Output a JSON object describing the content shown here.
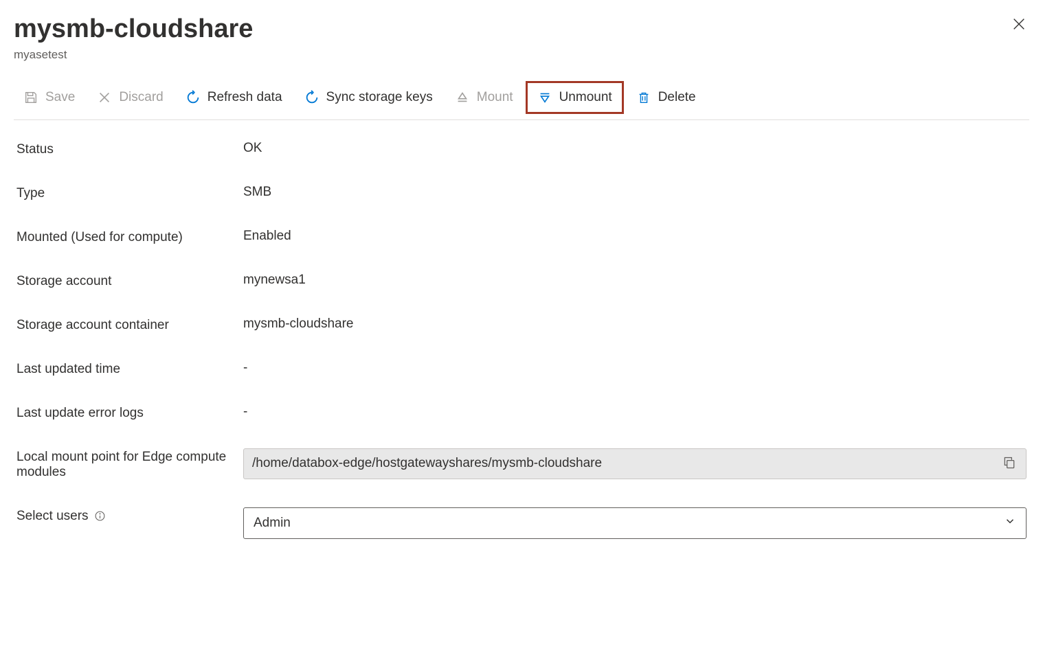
{
  "header": {
    "title": "mysmb-cloudshare",
    "subtitle": "myasetest"
  },
  "toolbar": {
    "save": "Save",
    "discard": "Discard",
    "refresh": "Refresh data",
    "sync": "Sync storage keys",
    "mount": "Mount",
    "unmount": "Unmount",
    "delete": "Delete"
  },
  "fields": {
    "status": {
      "label": "Status",
      "value": "OK"
    },
    "type": {
      "label": "Type",
      "value": "SMB"
    },
    "mounted": {
      "label": "Mounted (Used for compute)",
      "value": "Enabled"
    },
    "storage_account": {
      "label": "Storage account",
      "value": "mynewsa1"
    },
    "storage_account_container": {
      "label": "Storage account container",
      "value": "mysmb-cloudshare"
    },
    "last_updated_time": {
      "label": "Last updated time",
      "value": "-"
    },
    "last_update_error_logs": {
      "label": "Last update error logs",
      "value": "-"
    },
    "local_mount_point": {
      "label": "Local mount point for Edge compute modules",
      "value": "/home/databox-edge/hostgatewayshares/mysmb-cloudshare"
    },
    "select_users": {
      "label": "Select users",
      "value": "Admin"
    }
  }
}
